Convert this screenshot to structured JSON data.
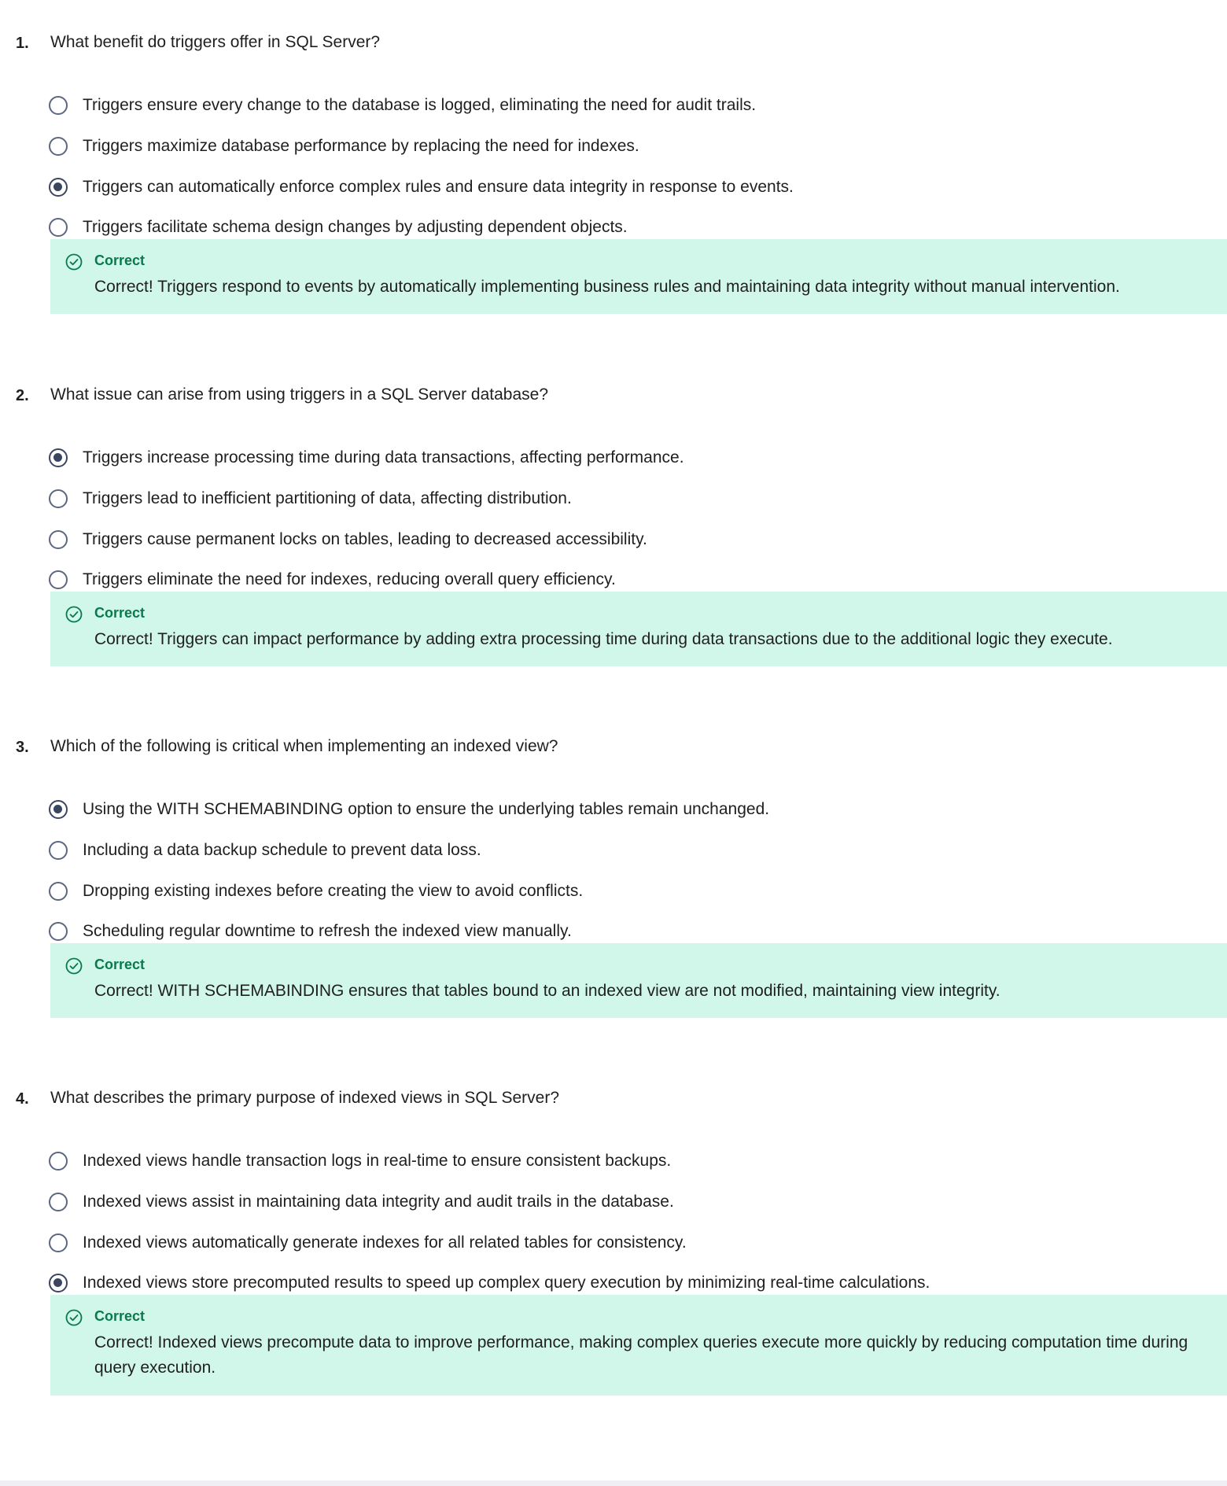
{
  "questions": [
    {
      "number": "1.",
      "text": "What benefit do triggers offer in SQL Server?",
      "options": [
        {
          "label": "Triggers ensure every change to the database is logged, eliminating the need for audit trails.",
          "selected": false
        },
        {
          "label": "Triggers maximize database performance by replacing the need for indexes.",
          "selected": false
        },
        {
          "label": "Triggers can automatically enforce complex rules and ensure data integrity in response to events.",
          "selected": true
        },
        {
          "label": "Triggers facilitate schema design changes by adjusting dependent objects.",
          "selected": false
        }
      ],
      "feedback": {
        "title": "Correct",
        "text": "Correct! Triggers respond to events by automatically implementing business rules and maintaining data integrity without manual intervention."
      }
    },
    {
      "number": "2.",
      "text": "What issue can arise from using triggers in a SQL Server database?",
      "options": [
        {
          "label": "Triggers increase processing time during data transactions, affecting performance.",
          "selected": true
        },
        {
          "label": "Triggers lead to inefficient partitioning of data, affecting distribution.",
          "selected": false
        },
        {
          "label": "Triggers cause permanent locks on tables, leading to decreased accessibility.",
          "selected": false
        },
        {
          "label": "Triggers eliminate the need for indexes, reducing overall query efficiency.",
          "selected": false
        }
      ],
      "feedback": {
        "title": "Correct",
        "text": "Correct! Triggers can impact performance by adding extra processing time during data transactions due to the additional logic they execute."
      }
    },
    {
      "number": "3.",
      "text": "Which of the following is critical when implementing an indexed view?",
      "options": [
        {
          "label": "Using the WITH SCHEMABINDING option to ensure the underlying tables remain unchanged.",
          "selected": true
        },
        {
          "label": "Including a data backup schedule to prevent data loss.",
          "selected": false
        },
        {
          "label": "Dropping existing indexes before creating the view to avoid conflicts.",
          "selected": false
        },
        {
          "label": "Scheduling regular downtime to refresh the indexed view manually.",
          "selected": false
        }
      ],
      "feedback": {
        "title": "Correct",
        "text": "Correct! WITH SCHEMABINDING ensures that tables bound to an indexed view are not modified, maintaining view integrity."
      }
    },
    {
      "number": "4.",
      "text": "What describes the primary purpose of indexed views in SQL Server?",
      "options": [
        {
          "label": "Indexed views handle transaction logs in real-time to ensure consistent backups.",
          "selected": false
        },
        {
          "label": "Indexed views assist in maintaining data integrity and audit trails in the database.",
          "selected": false
        },
        {
          "label": "Indexed views automatically generate indexes for all related tables for consistency.",
          "selected": false
        },
        {
          "label": "Indexed views store precomputed results to speed up complex query execution by minimizing real-time calculations.",
          "selected": true
        }
      ],
      "feedback": {
        "title": "Correct",
        "text": "Correct! Indexed views precompute data to improve performance, making complex queries execute more quickly by reducing computation time during query execution."
      }
    }
  ],
  "colors": {
    "feedback_background": "#d1f7ea",
    "feedback_title": "#087a4e",
    "radio_border": "#5b6780",
    "radio_selected_dot": "#3a4660",
    "text": "#1f1f1f"
  },
  "icons": {
    "feedback": "check-circle-icon",
    "option_unselected": "radio-empty-icon",
    "option_selected": "radio-filled-icon"
  }
}
